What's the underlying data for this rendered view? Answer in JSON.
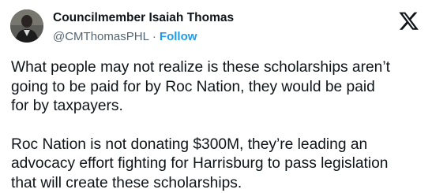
{
  "author": {
    "display_name": "Councilmember Isaiah Thomas",
    "handle": "@CMThomasPHL",
    "separator": "·",
    "follow_label": "Follow",
    "avatar_icon": "profile-photo-icon",
    "logo_icon": "x-logo-icon"
  },
  "tweet": {
    "paragraphs": [
      "What people may not realize is these scholarships aren’t\ngoing to be paid for by Roc Nation, they would be paid\nfor by taxpayers.",
      "Roc Nation is not donating $300M, they’re leading an\nadvocacy effort fighting for Harrisburg to pass legislation\nthat will create these scholarships."
    ]
  },
  "colors": {
    "text": "#0f1419",
    "secondary": "#536471",
    "accent": "#1d9bf0"
  }
}
